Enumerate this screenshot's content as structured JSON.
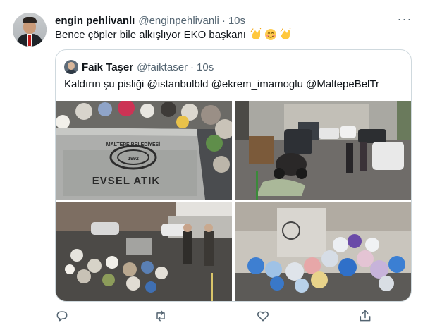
{
  "tweet": {
    "author_name": "engin pehlivanlı",
    "author_handle": "@enginpehlivanli",
    "separator": "·",
    "time": "10s",
    "more": "···",
    "text": "Bence çöpler bile alkışlıyor EKO başkanı",
    "emojis": [
      "clapping-hands",
      "smiling-face-with-smiling-eyes",
      "clapping-hands"
    ]
  },
  "quoted": {
    "author_name": "Faik Taşer",
    "author_handle": "@faiktaser",
    "separator": "·",
    "time": "10s",
    "text": "Kaldırın şu pisliği @istanbulbld @ekrem_imamoglu @MaltepeBelTr",
    "photos": [
      {
        "subject": "overflowing-garbage-container",
        "container_text": "EVSEL ATIK",
        "container_seal": "MALTEPE BELEDİYESİ 1992"
      },
      {
        "subject": "street-with-garbage-and-parked-cars"
      },
      {
        "subject": "street-garbage-pile-with-pedestrians"
      },
      {
        "subject": "garbage-bags-piled-by-container"
      }
    ]
  },
  "actions": [
    {
      "icon": "reply-icon"
    },
    {
      "icon": "retweet-icon"
    },
    {
      "icon": "like-icon"
    },
    {
      "icon": "share-icon"
    }
  ],
  "colors": {
    "text": "#0f1419",
    "secondary": "#536471",
    "border": "#cfd9de",
    "emoji": "#ffc83d"
  }
}
